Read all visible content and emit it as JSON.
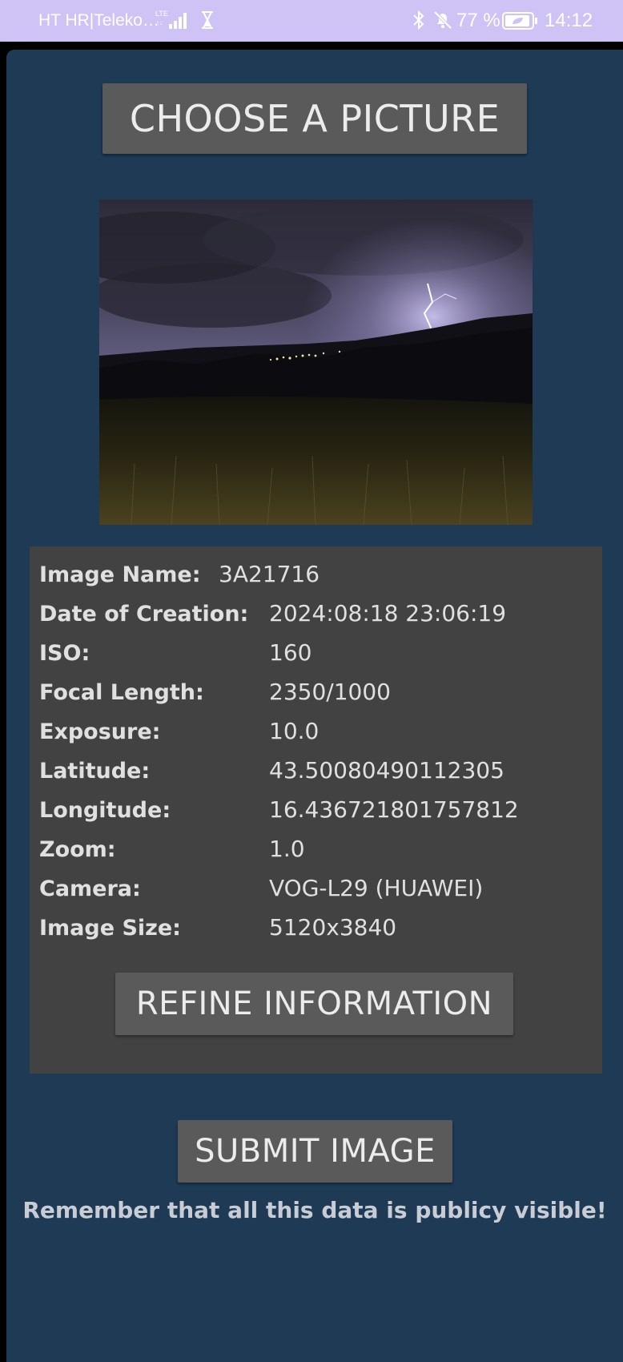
{
  "status_bar": {
    "carrier": "HT HR|Teleko…",
    "network_type": "LTE",
    "battery_percent": "77 %",
    "time": "14:12"
  },
  "app": {
    "choose_button": "CHOOSE A PICTURE",
    "info": [
      {
        "label": "Image Name:",
        "value": "3A21716"
      },
      {
        "label": "Date of Creation:",
        "value": "2024:08:18 23:06:19"
      },
      {
        "label": "ISO:",
        "value": "160"
      },
      {
        "label": "Focal Length:",
        "value": "2350/1000"
      },
      {
        "label": "Exposure:",
        "value": "10.0"
      },
      {
        "label": "Latitude:",
        "value": "43.50080490112305"
      },
      {
        "label": "Longitude:",
        "value": "16.436721801757812"
      },
      {
        "label": "Zoom:",
        "value": "1.0"
      },
      {
        "label": "Camera:",
        "value": "VOG-L29 (HUAWEI)"
      },
      {
        "label": "Image Size:",
        "value": "5120x3840"
      }
    ],
    "refine_button": "REFINE INFORMATION",
    "submit_button": "SUBMIT IMAGE",
    "notice": "Remember that all this data is publicy visible!"
  },
  "colors": {
    "status_bar": "#cfc2f5",
    "app_background": "#1e3a55",
    "panel": "#424242",
    "button": "#5a5a5a"
  }
}
